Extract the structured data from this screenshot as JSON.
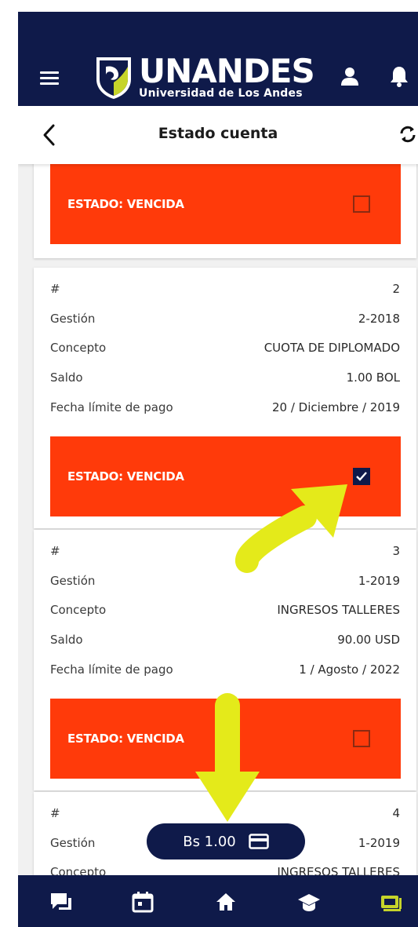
{
  "app": {
    "brand_title": "UNANDES",
    "brand_subtitle": "Universidad de Los Andes",
    "colors": {
      "primary": "#0f1a4a",
      "status_red": "#ff3a0a",
      "accent_green": "#c6d42a",
      "highlight_yellow": "#e4ea1a"
    }
  },
  "header": {
    "title": "Estado cuenta",
    "back_icon": "chevron-left-icon",
    "refresh_icon": "refresh-icon"
  },
  "labels": {
    "number": "#",
    "gestion": "Gestión",
    "concepto": "Concepto",
    "saldo": "Saldo",
    "fecha": "Fecha límite de pago"
  },
  "cards": [
    {
      "status": "ESTADO: VENCIDA",
      "checked": false
    },
    {
      "number": "2",
      "gestion": "2-2018",
      "concepto": "CUOTA DE DIPLOMADO",
      "saldo": "1.00 BOL",
      "fecha": "20 / Diciembre / 2019",
      "status": "ESTADO: VENCIDA",
      "checked": true
    },
    {
      "number": "3",
      "gestion": "1-2019",
      "concepto": "INGRESOS TALLERES",
      "saldo": "90.00 USD",
      "fecha": "1 / Agosto / 2022",
      "status": "ESTADO: VENCIDA",
      "checked": false
    },
    {
      "number": "4",
      "gestion": "1-2019",
      "concepto": "INGRESOS TALLERES"
    }
  ],
  "payment": {
    "amount": "Bs 1.00",
    "icon": "credit-card-icon"
  },
  "bottom_nav": [
    {
      "icon": "chat-icon"
    },
    {
      "icon": "calendar-icon"
    },
    {
      "icon": "home-icon"
    },
    {
      "icon": "graduation-cap-icon"
    },
    {
      "icon": "wallet-icon",
      "active": true
    }
  ]
}
